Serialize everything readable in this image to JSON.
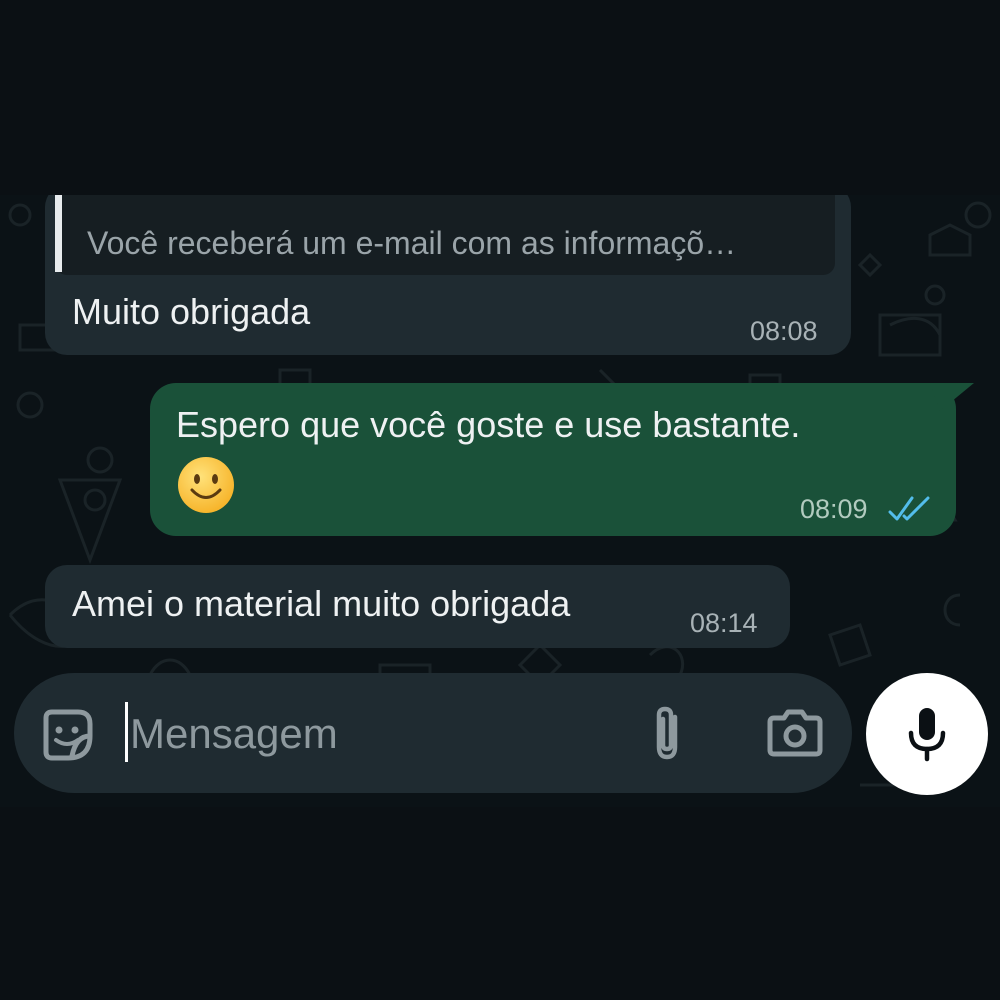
{
  "conversation": {
    "messages": [
      {
        "direction": "incoming",
        "quoted_text": "Você receberá um e-mail com as informaçõ…",
        "text": "Muito obrigada",
        "time": "08:08"
      },
      {
        "direction": "outgoing",
        "text": "Espero que você goste e use bastante.",
        "emoji": "smiling-face",
        "time": "08:09",
        "status": "read"
      },
      {
        "direction": "incoming",
        "text": "Amei o material muito obrigada",
        "time": "08:14"
      }
    ]
  },
  "composer": {
    "placeholder": "Mensagem",
    "icons": [
      "sticker-icon",
      "attach-icon",
      "camera-icon",
      "mic-icon"
    ]
  },
  "colors": {
    "background": "#0b1014",
    "incoming_bubble": "#1f2b31",
    "outgoing_bubble": "#1a5139",
    "read_ticks": "#53bdeb",
    "mic_button": "#ffffff"
  }
}
